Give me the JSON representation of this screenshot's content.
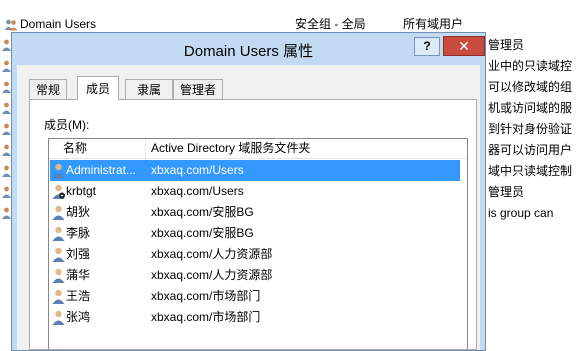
{
  "background": {
    "header_row": {
      "name": "Domain Users",
      "type": "安全组 - 全局",
      "description": "所有域用户"
    },
    "right_descriptions": [
      "管理员",
      "业中的只读域控",
      "可以修改域的组",
      "机或访问域的服",
      "到针对身份验证",
      "器可以访问用户",
      "域中只读域控制",
      "管理员",
      "is group can"
    ]
  },
  "dialog": {
    "title": "Domain Users 属性",
    "help_label": "?",
    "close_label": "✕",
    "tabs": [
      "常规",
      "成员",
      "隶属于",
      "管理者"
    ],
    "active_tab": "成员",
    "members_label": "成员(M):",
    "columns": {
      "name": "名称",
      "folder": "Active Directory 域服务文件夹"
    },
    "members": [
      {
        "name": "Administrat...",
        "folder": "xbxaq.com/Users"
      },
      {
        "name": "krbtgt",
        "folder": "xbxaq.com/Users"
      },
      {
        "name": "胡狄",
        "folder": "xbxaq.com/安服BG"
      },
      {
        "name": "李脉",
        "folder": "xbxaq.com/安服BG"
      },
      {
        "name": "刘强",
        "folder": "xbxaq.com/人力资源部"
      },
      {
        "name": "蒲华",
        "folder": "xbxaq.com/人力资源部"
      },
      {
        "name": "王浩",
        "folder": "xbxaq.com/市场部门"
      },
      {
        "name": "张鸿",
        "folder": "xbxaq.com/市场部门"
      }
    ]
  }
}
